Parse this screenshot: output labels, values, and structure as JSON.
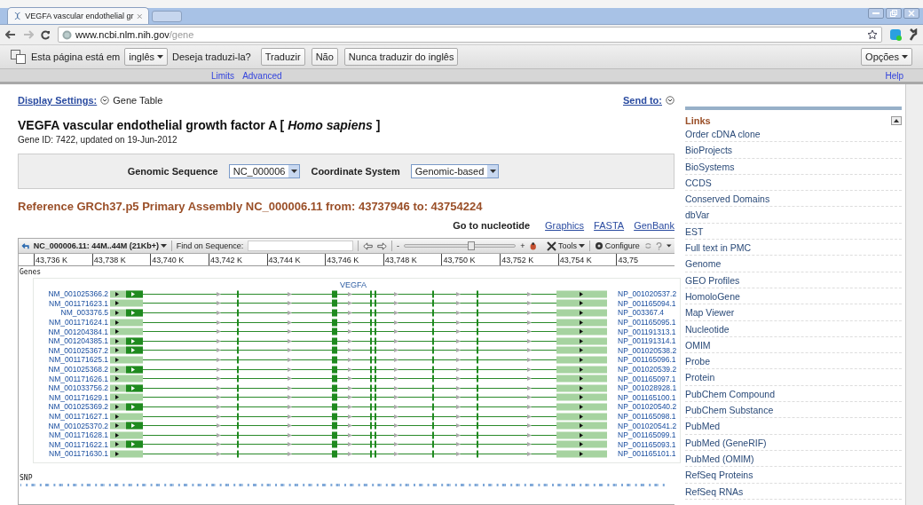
{
  "browser": {
    "tab_title": "VEGFA vascular endothelial gr",
    "url_host": "www.ncbi.nlm.nih.gov",
    "url_path": "/gene"
  },
  "translate_bar": {
    "prefix": "Esta página está em",
    "language": "inglês",
    "question": "Deseja traduzi-la?",
    "buttons": [
      "Traduzir",
      "Não",
      "Nunca traduzir do inglês"
    ],
    "options": "Opções"
  },
  "site_header": {
    "links": [
      "Limits",
      "Advanced"
    ],
    "help": "Help"
  },
  "display_settings": {
    "label": "Display Settings:",
    "value": "Gene Table",
    "send_to": "Send to:"
  },
  "gene": {
    "title": "VEGFA vascular endothelial growth factor A [ *Homo sapiens* ]",
    "meta": "Gene ID: 7422, updated on 19-Jun-2012"
  },
  "selector": {
    "sequence_label": "Genomic Sequence",
    "sequence_value": "NC_000006",
    "coordinate_label": "Coordinate System",
    "coordinate_value": "Genomic-based"
  },
  "reference": "Reference GRCh37.p5 Primary Assembly NC_000006.11 from: 43737946 to: 43754224",
  "goto": {
    "label": "Go to nucleotide",
    "links": [
      "Graphics",
      "FASTA",
      "GenBank"
    ]
  },
  "viewer": {
    "range": "NC_000006.11: 44M..44M (21Kb+)",
    "find_label": "Find on Sequence:",
    "zoom_minus": "-",
    "zoom_plus": "+",
    "zoom_slider": {
      "level": 0.6
    },
    "tools": "Tools",
    "configure": "Configure",
    "ticks": [
      "43,736 K",
      "43,738 K",
      "43,740 K",
      "43,742 K",
      "43,744 K",
      "43,746 K",
      "43,748 K",
      "43,750 K",
      "43,752 K",
      "43,754 K",
      "43,75"
    ],
    "genes_track": "Genes",
    "gene_name": "VEGFA",
    "snp_track": "SNP",
    "transcripts": [
      {
        "rna": "NM_001025366.2",
        "protein": "NP_001020537.2",
        "coding_first_exon": true
      },
      {
        "rna": "NM_001171623.1",
        "protein": "NP_001165094.1",
        "coding_first_exon": false
      },
      {
        "rna": "NM_003376.5",
        "protein": "NP_003367.4",
        "coding_first_exon": true
      },
      {
        "rna": "NM_001171624.1",
        "protein": "NP_001165095.1",
        "coding_first_exon": false
      },
      {
        "rna": "NM_001204384.1",
        "protein": "NP_001191313.1",
        "coding_first_exon": false
      },
      {
        "rna": "NM_001204385.1",
        "protein": "NP_001191314.1",
        "coding_first_exon": true
      },
      {
        "rna": "NM_001025367.2",
        "protein": "NP_001020538.2",
        "coding_first_exon": true
      },
      {
        "rna": "NM_001171625.1",
        "protein": "NP_001165096.1",
        "coding_first_exon": false
      },
      {
        "rna": "NM_001025368.2",
        "protein": "NP_001020539.2",
        "coding_first_exon": true
      },
      {
        "rna": "NM_001171626.1",
        "protein": "NP_001165097.1",
        "coding_first_exon": false
      },
      {
        "rna": "NM_001033756.2",
        "protein": "NP_001028928.1",
        "coding_first_exon": true
      },
      {
        "rna": "NM_001171629.1",
        "protein": "NP_001165100.1",
        "coding_first_exon": false
      },
      {
        "rna": "NM_001025369.2",
        "protein": "NP_001020540.2",
        "coding_first_exon": true
      },
      {
        "rna": "NM_001171627.1",
        "protein": "NP_001165098.1",
        "coding_first_exon": false
      },
      {
        "rna": "NM_001025370.2",
        "protein": "NP_001020541.2",
        "coding_first_exon": true
      },
      {
        "rna": "NM_001171628.1",
        "protein": "NP_001165099.1",
        "coding_first_exon": false
      },
      {
        "rna": "NM_001171622.1",
        "protein": "NP_001165093.1",
        "coding_first_exon": true
      },
      {
        "rna": "NM_001171630.1",
        "protein": "NP_001165101.1",
        "coding_first_exon": false
      }
    ]
  },
  "links": {
    "title": "Links",
    "items": [
      "Order cDNA clone",
      "BioProjects",
      "BioSystems",
      "CCDS",
      "Conserved Domains",
      "dbVar",
      "EST",
      "Full text in PMC",
      "Genome",
      "GEO Profiles",
      "HomoloGene",
      "Map Viewer",
      "Nucleotide",
      "OMIM",
      "Probe",
      "Protein",
      "PubChem Compound",
      "PubChem Substance",
      "PubMed",
      "PubMed (GeneRIF)",
      "PubMed (OMIM)",
      "RefSeq Proteins",
      "RefSeq RNAs"
    ]
  }
}
